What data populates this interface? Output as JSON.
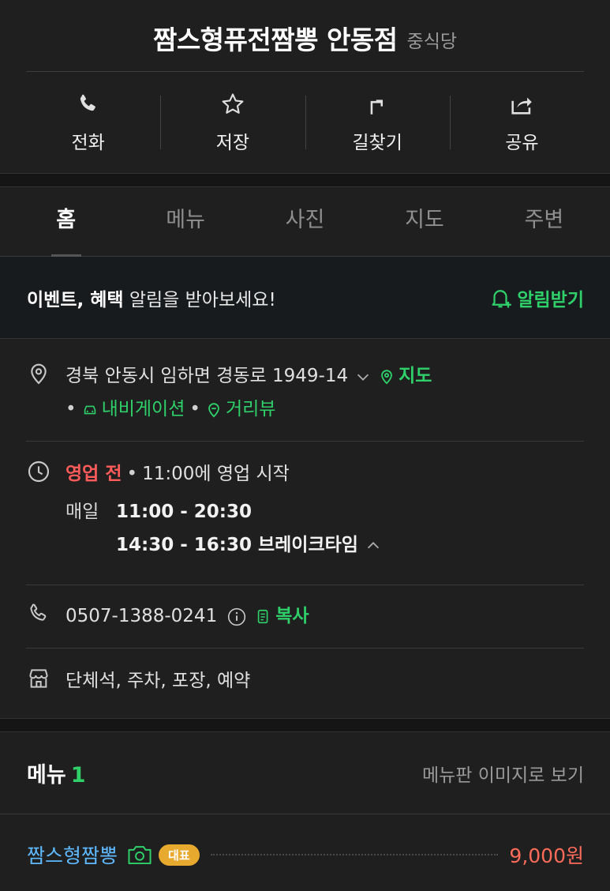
{
  "header": {
    "title": "짬스형퓨전짬뽕 안동점",
    "category": "중식당"
  },
  "actions": [
    {
      "label": "전화",
      "icon": "phone-icon"
    },
    {
      "label": "저장",
      "icon": "star-icon"
    },
    {
      "label": "길찾기",
      "icon": "directions-icon"
    },
    {
      "label": "공유",
      "icon": "share-icon"
    }
  ],
  "tabs": [
    "홈",
    "메뉴",
    "사진",
    "지도",
    "주변"
  ],
  "notice": {
    "bold": "이벤트, 혜택",
    "rest": " 알림을 받아보세요!",
    "button": "알림받기"
  },
  "address": {
    "text": "경북 안동시 임하면 경동로 1949-14",
    "map": "지도",
    "navigation": "내비게이션",
    "street_view": "거리뷰"
  },
  "hours": {
    "status": "영업 전",
    "status_detail": "11:00에 영업 시작",
    "day": "매일",
    "open": "11:00 - 20:30",
    "break": "14:30 - 16:30 브레이크타임"
  },
  "phone": {
    "number": "0507-1388-0241",
    "copy": "복사"
  },
  "amenities": "단체석, 주차, 포장, 예약",
  "menu": {
    "title": "메뉴",
    "count": "1",
    "link": "메뉴판 이미지로 보기",
    "items": [
      {
        "name": "짬스형짬뽕",
        "badge": "대표",
        "price": "9,000원"
      }
    ]
  },
  "colors": {
    "accent_green": "#2fd06a",
    "status_red": "#ff5b5b",
    "menu_blue": "#5fb9ff",
    "badge_orange": "#e8a92f",
    "price_red": "#ff6b5b"
  }
}
